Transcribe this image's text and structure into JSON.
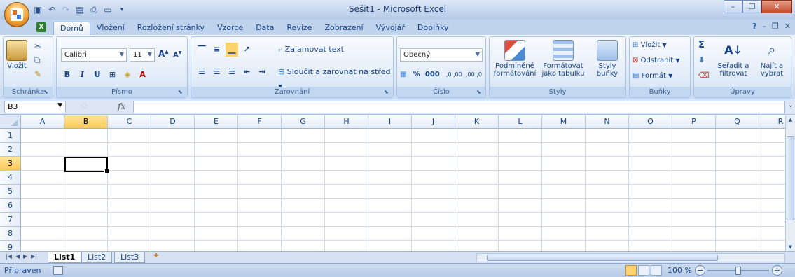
{
  "window": {
    "title": "Sešit1 - Microsoft Excel"
  },
  "quick_access": [
    "save-icon",
    "undo-icon",
    "redo-icon",
    "print-preview-icon",
    "print-icon",
    "new-icon"
  ],
  "tabs": [
    "Domů",
    "Vložení",
    "Rozložení stránky",
    "Vzorce",
    "Data",
    "Revize",
    "Zobrazení",
    "Vývojář",
    "Doplňky"
  ],
  "active_tab": "Domů",
  "ribbon": {
    "clipboard": {
      "label": "Schránka",
      "paste": "Vložit"
    },
    "font": {
      "label": "Písmo",
      "name": "Calibri",
      "size": "11",
      "bold": "B",
      "italic": "I",
      "underline": "U"
    },
    "alignment": {
      "label": "Zarovnání",
      "wrap": "Zalamovat text",
      "merge": "Sloučit a zarovnat na střed"
    },
    "number": {
      "label": "Číslo",
      "format": "Obecný",
      "percent": "%",
      "thousands": "000",
      "inc_decimal": ",0 ,00",
      "dec_decimal": ",00 ,0"
    },
    "styles": {
      "label": "Styly",
      "conditional": "Podmíněné formátování",
      "as_table": "Formátovat jako tabulku",
      "cell_styles": "Styly buňky"
    },
    "cells": {
      "label": "Buňky",
      "insert": "Vložit",
      "delete": "Odstranit",
      "format": "Formát"
    },
    "editing": {
      "label": "Úpravy",
      "sum": "Σ",
      "sort": "Seřadit a filtrovat",
      "find": "Najít a vybrat"
    }
  },
  "formula_bar": {
    "name_box": "B3",
    "fx": "fx",
    "value": ""
  },
  "columns": [
    "A",
    "B",
    "C",
    "D",
    "E",
    "F",
    "G",
    "H",
    "I",
    "J",
    "K",
    "L",
    "M",
    "N",
    "O",
    "P",
    "Q",
    "R"
  ],
  "rows": [
    "1",
    "2",
    "3",
    "4",
    "5",
    "6",
    "7",
    "8",
    "9"
  ],
  "selected": {
    "column": "B",
    "row": "3"
  },
  "sheets": [
    "List1",
    "List2",
    "List3"
  ],
  "active_sheet": "List1",
  "status": {
    "ready": "Připraven",
    "zoom": "100 %",
    "zoom_minus": "−",
    "zoom_plus": "+"
  },
  "colors": {
    "accent": "#15428b",
    "ribbon": "#dbe7f6",
    "selection": "#ffc85a"
  }
}
